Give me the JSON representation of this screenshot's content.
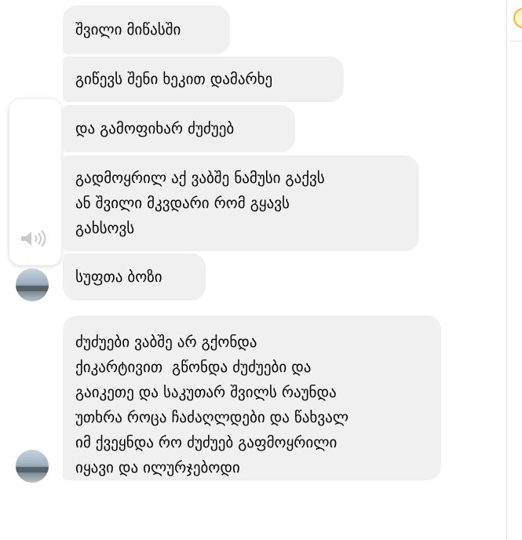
{
  "messages": [
    {
      "text": "შვილი მიწასში"
    },
    {
      "text": "გიწევს შენი ხეკით დამარხე"
    },
    {
      "text": "და გამოფიხარ ძუძუებ"
    },
    {
      "text": "გადმოყრილ აქ ვაბშე ნამუსი გაქვს\nან შვილი მკვდარი რომ გყავს\nგახსოვს"
    },
    {
      "text": "სუფთა ბოზი"
    },
    {
      "text": "ძუძუები ვაბშე არ გქონდა\nქიკარტივით  გწონდა ძუძუები და\nგაიკეთე და საკუთარ შვილს რაუნდა\nუთხრა როცა ჩაძაღლდები და წახვალ\nიმ ქვეყნდა რო ძუძუებ გაფმოყრილი\nიყავი და ილურჯებოდი"
    }
  ],
  "icons": {
    "audio": "speaker-volume-icon"
  },
  "colors": {
    "bubble": "#f0f0f0",
    "text": "#050505",
    "corner_ring": "#f7b928"
  }
}
